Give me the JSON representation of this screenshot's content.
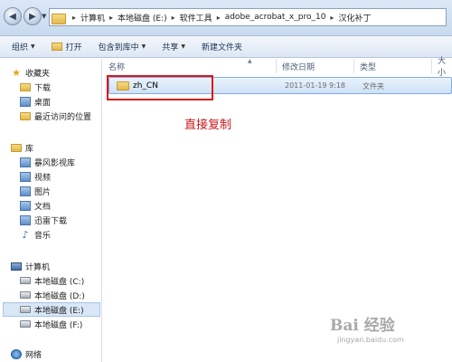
{
  "address_bar": {
    "crumbs": [
      "计算机",
      "本地磁盘 (E:)",
      "软件工具",
      "adobe_acrobat_x_pro_10",
      "汉化补丁"
    ]
  },
  "toolbar": {
    "organize": "组织",
    "open": "打开",
    "include_in_library": "包含到库中",
    "share": "共享",
    "new_folder": "新建文件夹"
  },
  "nav": {
    "favorites": "收藏夹",
    "downloads": "下载",
    "desktop": "桌面",
    "recent": "最近访问的位置",
    "libraries": "库",
    "storm_video": "暴风影视库",
    "videos": "视频",
    "pictures": "图片",
    "documents": "文档",
    "thunder_downloads": "迅雷下载",
    "music": "音乐",
    "computer": "计算机",
    "drive_c": "本地磁盘 (C:)",
    "drive_d": "本地磁盘 (D:)",
    "drive_e": "本地磁盘 (E:)",
    "drive_f": "本地磁盘 (F:)",
    "network": "网络"
  },
  "columns": {
    "name": "名称",
    "date_modified": "修改日期",
    "type": "类型",
    "size": "大小"
  },
  "files": [
    {
      "name": "zh_CN",
      "date": "2011-01-19 9:18",
      "type": "文件夹"
    }
  ],
  "annotation": "直接复制",
  "watermark": {
    "main": "Bai 经验",
    "sub": "jingyan.baidu.com"
  }
}
